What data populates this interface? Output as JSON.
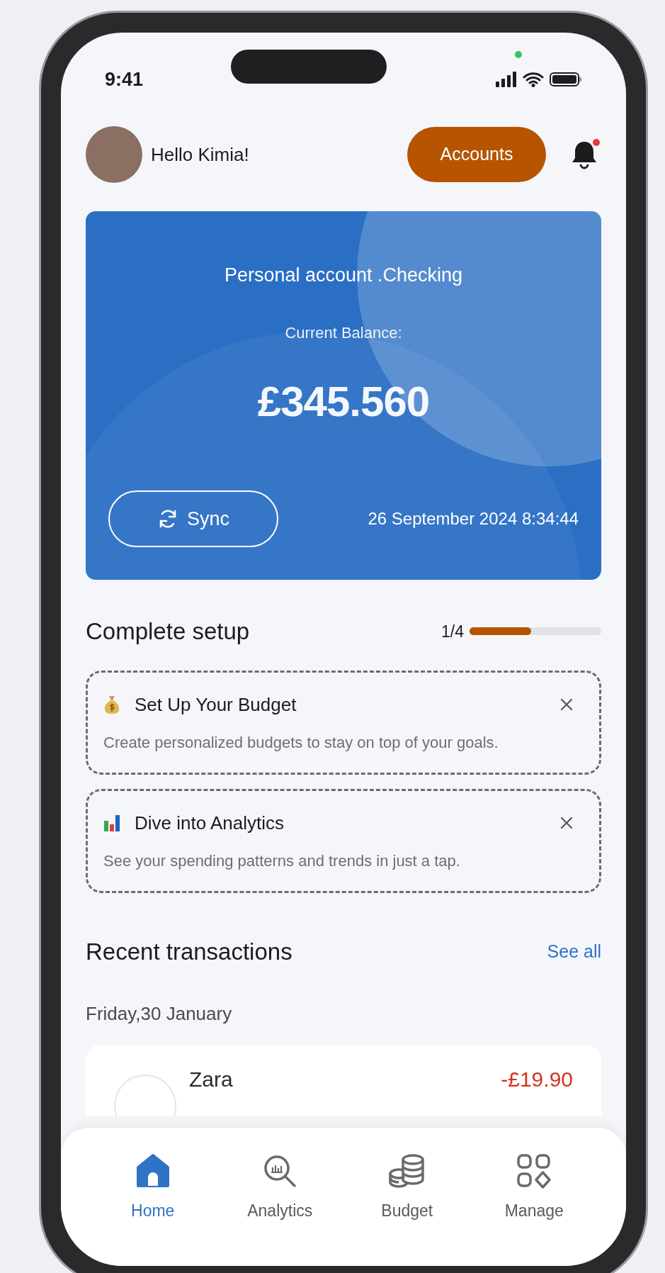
{
  "status_bar": {
    "time": "9:41"
  },
  "header": {
    "greeting": "Hello Kimia!",
    "accounts_button": "Accounts",
    "notification_badge": true
  },
  "balance_card": {
    "account": "Personal account .Checking",
    "balance_label": "Current Balance:",
    "balance": "£345.560",
    "sync_button": "Sync",
    "updated": "26 September 2024 8:34:44"
  },
  "setup": {
    "title": "Complete setup",
    "progress_text": "1/4",
    "level": 0.47,
    "tasks": [
      {
        "kind": "budget",
        "title": "Set Up Your Budget",
        "description": "Create personalized budgets to stay on top of your goals."
      },
      {
        "kind": "analytics",
        "title": "Dive into Analytics",
        "description": "See your spending patterns and trends in just a tap."
      }
    ]
  },
  "transactions": {
    "title": "Recent transactions",
    "see_all": "See all",
    "date": "Friday,30 January",
    "items": [
      {
        "merchant": "Zara",
        "amount": "-£19.90"
      }
    ]
  },
  "nav": [
    {
      "kind": "home",
      "label": "Home",
      "selected": true
    },
    {
      "kind": "analytics",
      "label": "Analytics",
      "selected": false
    },
    {
      "kind": "budget",
      "label": "Budget",
      "selected": false
    },
    {
      "kind": "manage",
      "label": "Manage",
      "selected": false
    }
  ]
}
